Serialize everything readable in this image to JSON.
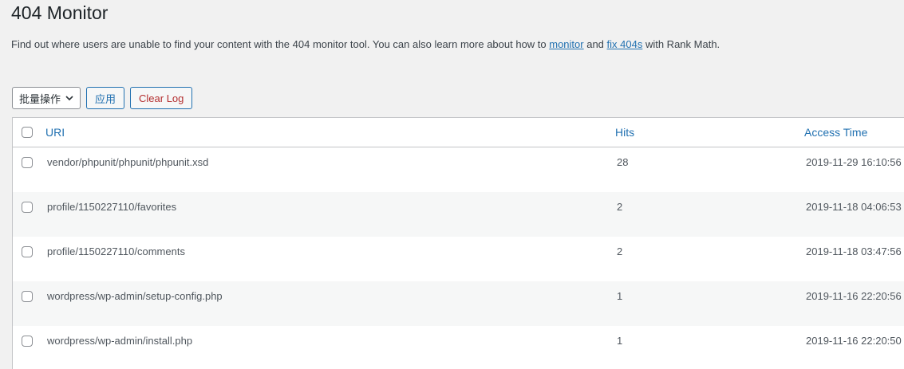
{
  "page": {
    "title": "404 Monitor",
    "description_prefix": "Find out where users are unable to find your content with the 404 monitor tool. You can also learn more about how to ",
    "link_monitor": "monitor",
    "description_mid": " and ",
    "link_fix": "fix 404s",
    "description_suffix": " with Rank Math."
  },
  "toolbar": {
    "bulk_select_value": "批量操作",
    "apply_label": "应用",
    "clear_log_label": "Clear Log"
  },
  "table": {
    "headers": {
      "uri": "URI",
      "hits": "Hits",
      "access_time": "Access Time"
    },
    "rows": [
      {
        "uri": "vendor/phpunit/phpunit/phpunit.xsd",
        "hits": "28",
        "time": "2019-11-29 16:10:56"
      },
      {
        "uri": "profile/1150227110/favorites",
        "hits": "2",
        "time": "2019-11-18 04:06:53"
      },
      {
        "uri": "profile/1150227110/comments",
        "hits": "2",
        "time": "2019-11-18 03:47:56"
      },
      {
        "uri": "wordpress/wp-admin/setup-config.php",
        "hits": "1",
        "time": "2019-11-16 22:20:56"
      },
      {
        "uri": "wordpress/wp-admin/install.php",
        "hits": "1",
        "time": "2019-11-16 22:20:50"
      }
    ]
  },
  "colors": {
    "link": "#2271b1",
    "danger": "#b32d2e",
    "background": "#f1f1f1"
  }
}
